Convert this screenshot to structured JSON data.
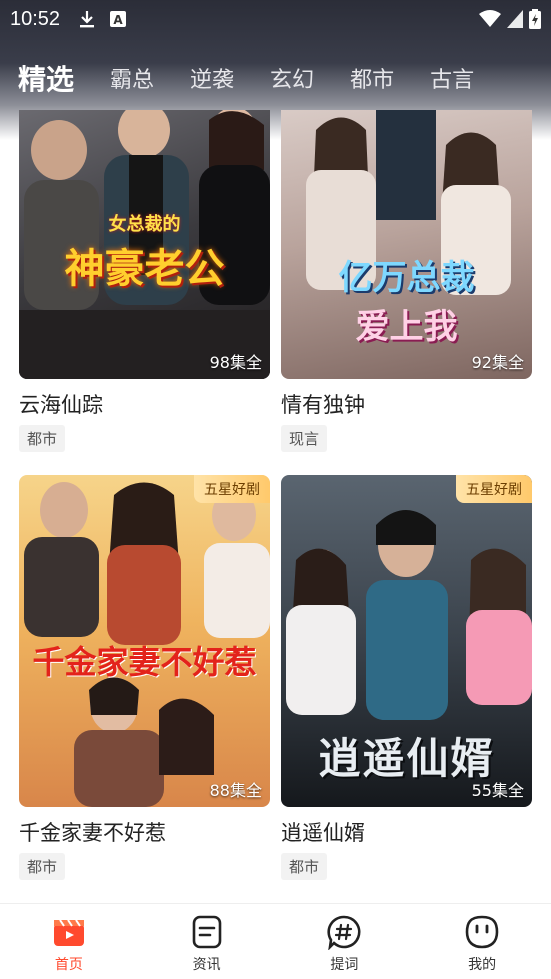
{
  "status_bar": {
    "time": "10:52"
  },
  "tabs": [
    {
      "label": "精选",
      "active": true
    },
    {
      "label": "霸总",
      "active": false
    },
    {
      "label": "逆袭",
      "active": false
    },
    {
      "label": "玄幻",
      "active": false
    },
    {
      "label": "都市",
      "active": false
    },
    {
      "label": "古言",
      "active": false
    }
  ],
  "cards": [
    {
      "title": "云海仙踪",
      "tag": "都市",
      "episodes": "98集全",
      "badge": "",
      "poster_text": "女总裁的神豪老公",
      "poster_colors": [
        "#5b5a5e",
        "#2a2626"
      ]
    },
    {
      "title": "情有独钟",
      "tag": "现言",
      "episodes": "92集全",
      "badge": "",
      "poster_text": "亿万总裁爱上我",
      "poster_colors": [
        "#cdb9b5",
        "#8a6f6a"
      ]
    },
    {
      "title": "千金家妻不好惹",
      "tag": "都市",
      "episodes": "88集全",
      "badge": "五星好剧",
      "poster_text": "千金家妻不好惹",
      "poster_colors": [
        "#f3c26b",
        "#b86a3e"
      ]
    },
    {
      "title": "逍遥仙婿",
      "tag": "都市",
      "episodes": "55集全",
      "badge": "五星好剧",
      "poster_text": "逍遥仙婿",
      "poster_colors": [
        "#4b5660",
        "#1f2329"
      ]
    }
  ],
  "bottom_nav": [
    {
      "label": "首页",
      "icon": "clapperboard-icon",
      "active": true
    },
    {
      "label": "资讯",
      "icon": "document-icon",
      "active": false
    },
    {
      "label": "提词",
      "icon": "hashtag-icon",
      "active": false
    },
    {
      "label": "我的",
      "icon": "face-icon",
      "active": false
    }
  ],
  "colors": {
    "accent": "#ff4a2e",
    "badge_text": "#6b3d00"
  }
}
